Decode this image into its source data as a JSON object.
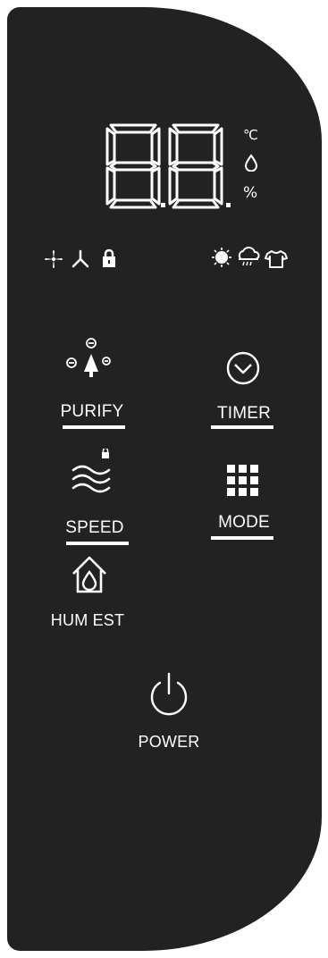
{
  "display": {
    "digits": "88",
    "unit_celsius": "℃",
    "unit_percent": "%"
  },
  "status_icons": {
    "left": [
      "fan-icon",
      "ion-icon",
      "lock-icon"
    ],
    "right": [
      "sun-icon",
      "rain-cloud-icon",
      "shirt-icon"
    ]
  },
  "buttons": {
    "purify": {
      "label": "PURIFY",
      "icon": "tree-ion-icon"
    },
    "timer": {
      "label": "TIMER",
      "icon": "clock-icon"
    },
    "speed": {
      "label": "SPEED",
      "icon": "wind-waves-icon"
    },
    "mode": {
      "label": "MODE",
      "icon": "grid-icon"
    },
    "hum_est": {
      "label": "HUM EST",
      "icon": "house-drop-icon"
    },
    "power": {
      "label": "POWER",
      "icon": "power-icon"
    }
  },
  "colors": {
    "panel": "#222223",
    "foreground": "#ffffff"
  }
}
